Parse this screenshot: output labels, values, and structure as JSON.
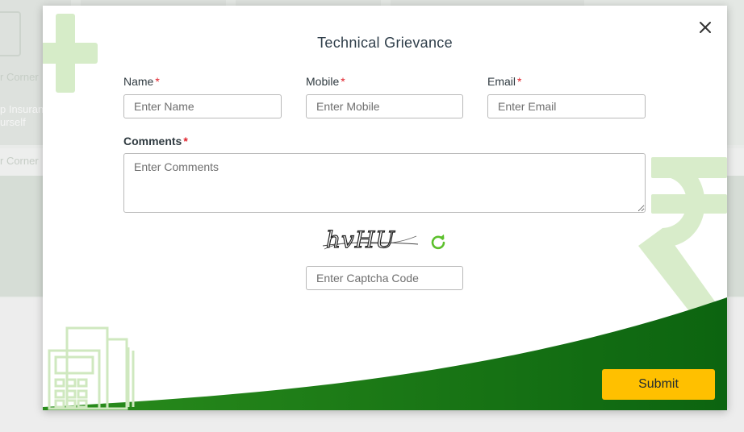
{
  "modal": {
    "title": "Technical Grievance",
    "close_glyph": "×",
    "required_mark": "*",
    "fields": {
      "name": {
        "label": "Name",
        "placeholder": "Enter Name",
        "value": ""
      },
      "mobile": {
        "label": "Mobile",
        "placeholder": "Enter Mobile",
        "value": ""
      },
      "email": {
        "label": "Email",
        "placeholder": "Enter Email",
        "value": ""
      },
      "comments": {
        "label": "Comments",
        "placeholder": "Enter Comments",
        "value": ""
      },
      "captcha": {
        "placeholder": "Enter Captcha Code",
        "value": ""
      }
    },
    "captcha_text": "hvHU",
    "refresh_icon": "refresh-icon",
    "submit_label": "Submit"
  },
  "background": {
    "texts": [
      "r Corner",
      "p Insuran",
      "urself",
      "r Corner"
    ]
  },
  "colors": {
    "accent_green": "#0f7a12",
    "light_green": "#d6ecc8",
    "submit_yellow": "#ffc000",
    "required_red": "#e0222b",
    "refresh_green": "#5cc02c"
  }
}
